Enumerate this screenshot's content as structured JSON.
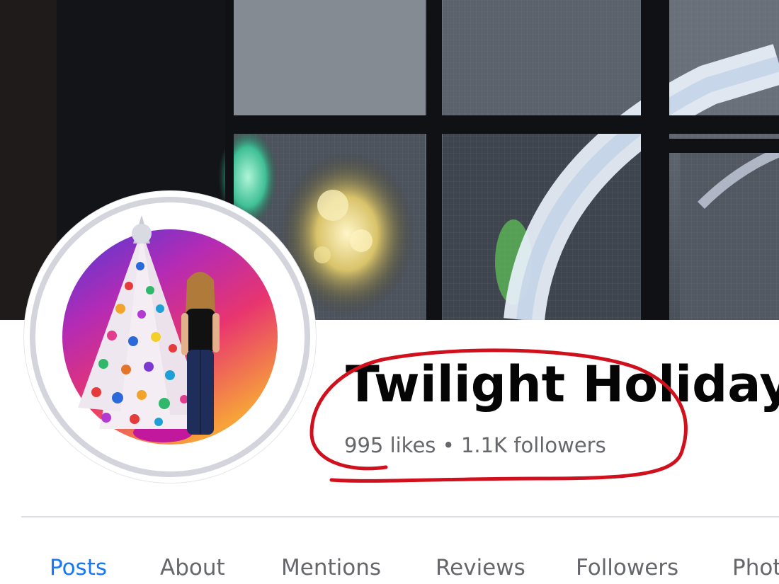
{
  "page": {
    "name": "Twilight Holiday",
    "stats": "995 likes • 1.1K followers"
  },
  "tabs": [
    {
      "label": "Posts",
      "active": true
    },
    {
      "label": "About",
      "active": false
    },
    {
      "label": "Mentions",
      "active": false
    },
    {
      "label": "Reviews",
      "active": false
    },
    {
      "label": "Followers",
      "active": false
    },
    {
      "label": "Photos",
      "active": false
    }
  ],
  "colors": {
    "accent": "#1877f2",
    "annotation": "#d0101c",
    "muted_text": "#65676b",
    "title_text": "#050505"
  }
}
